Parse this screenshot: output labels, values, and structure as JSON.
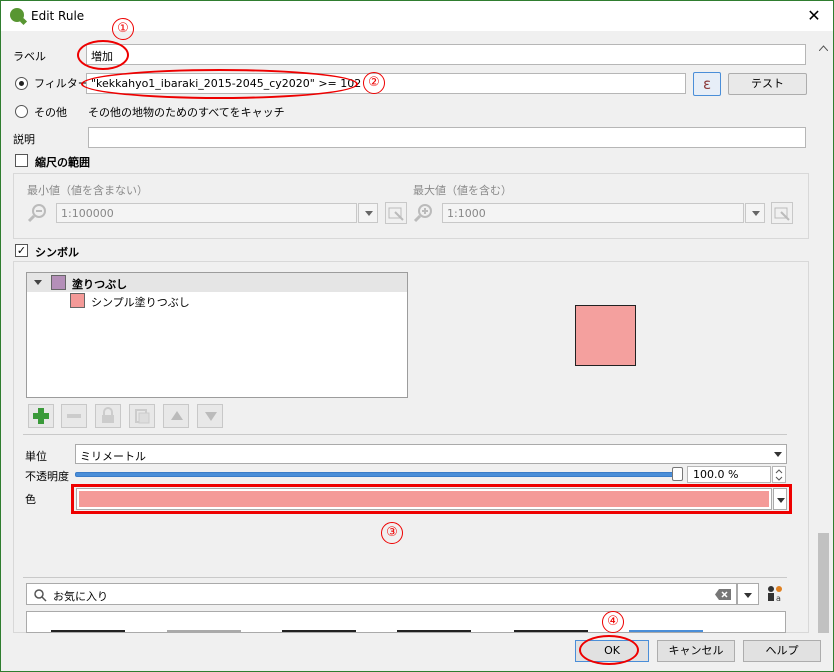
{
  "window": {
    "title": "Edit Rule",
    "close_glyph": "✕"
  },
  "label_row": {
    "label": "ラベル",
    "value": "増加"
  },
  "filter_row": {
    "label": "フィルター",
    "value": "\"kekkahyo1_ibaraki_2015-2045_cy2020\" >= 102",
    "expression_button_glyph": "ε",
    "test_button": "テスト"
  },
  "else_row": {
    "label": "その他",
    "description": "その他の地物のためのすべてをキャッチ"
  },
  "description_row": {
    "label": "説明",
    "value": ""
  },
  "scale_range": {
    "header": "縮尺の範囲",
    "checked": false,
    "min_label": "最小値（値を含まない）",
    "min_value": "1:100000",
    "max_label": "最大値（値を含む）",
    "max_value": "1:1000"
  },
  "symbol": {
    "header": "シンボル",
    "checked": true,
    "tree": [
      {
        "label": "塗りつぶし",
        "swatch": "#b48fb8",
        "expanded": true,
        "bold": true
      },
      {
        "label": "シンプル塗りつぶし",
        "swatch": "#f49a98",
        "bold": false
      }
    ],
    "preview_color": "#f4a09e"
  },
  "properties": {
    "unit_label": "単位",
    "unit_value": "ミリメートル",
    "opacity_label": "不透明度",
    "opacity_value": "100.0 %",
    "opacity_fraction": 1.0,
    "color_label": "色",
    "color_value": "#f49a98"
  },
  "favorites": {
    "search_placeholder": "お気に入り"
  },
  "buttons": {
    "ok": "OK",
    "cancel": "キャンセル",
    "help": "ヘルプ"
  },
  "annotations": {
    "n1": "①",
    "n2": "②",
    "n3": "③",
    "n4": "④"
  },
  "colors": {
    "annotation_red": "#e00000",
    "qgis_green": "#589632",
    "accent_blue": "#4a8ed8"
  }
}
